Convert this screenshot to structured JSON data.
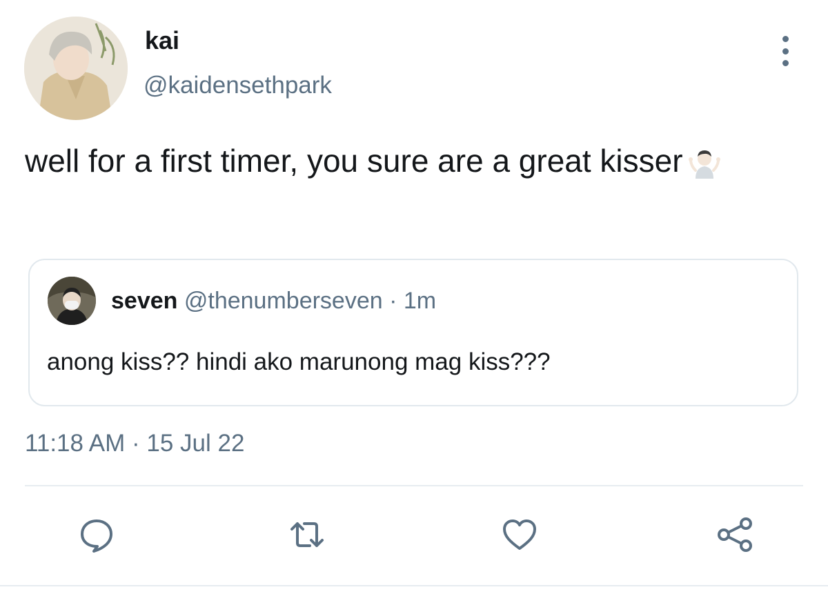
{
  "tweet": {
    "author_name": "kai",
    "author_handle": "@kaidensethpark",
    "text": "well for a first timer, you sure are a great kisser",
    "emoji_icon": "person-shrugging-emoji",
    "timestamp": "11:18 AM · 15 Jul 22"
  },
  "quoted": {
    "author_name": "seven",
    "author_handle": "@thenumberseven",
    "separator": "·",
    "time": "1m",
    "text": "anong kiss?? hindi ako marunong mag kiss???"
  },
  "actions": [
    {
      "name": "reply",
      "icon": "reply-icon"
    },
    {
      "name": "retweet",
      "icon": "retweet-icon"
    },
    {
      "name": "like",
      "icon": "heart-icon"
    },
    {
      "name": "share",
      "icon": "share-icon"
    }
  ],
  "colors": {
    "text": "#14171a",
    "secondary": "#5b7083",
    "border": "#e1e8ed"
  }
}
